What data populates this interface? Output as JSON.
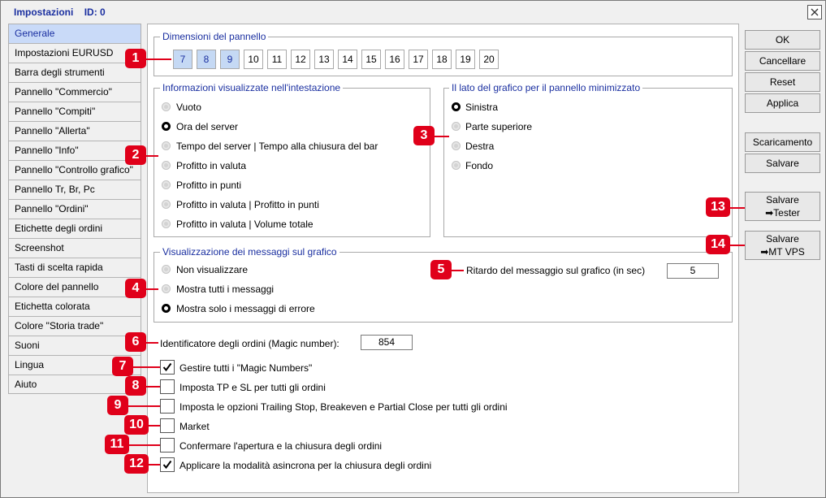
{
  "window": {
    "title": "Impostazioni",
    "id_label": "ID: 0"
  },
  "sidebar": {
    "items": [
      {
        "label": "Generale",
        "active": true
      },
      {
        "label": "Impostazioni EURUSD"
      },
      {
        "label": "Barra degli strumenti"
      },
      {
        "label": "Pannello \"Commercio\""
      },
      {
        "label": "Pannello \"Compiti\""
      },
      {
        "label": "Pannello \"Allerta\""
      },
      {
        "label": "Pannello \"Info\""
      },
      {
        "label": "Pannello \"Controllo grafico\""
      },
      {
        "label": "Pannello Tr, Br, Pc"
      },
      {
        "label": "Pannello \"Ordini\""
      },
      {
        "label": "Etichette degli ordini"
      },
      {
        "label": "Screenshot"
      },
      {
        "label": "Tasti di scelta rapida"
      },
      {
        "label": "Colore del pannello"
      },
      {
        "label": "Etichetta colorata"
      },
      {
        "label": "Colore \"Storia trade\""
      },
      {
        "label": "Suoni"
      },
      {
        "label": "Lingua"
      },
      {
        "label": "Aiuto"
      }
    ]
  },
  "panel_size": {
    "legend": "Dimensioni del pannello",
    "options": [
      "7",
      "8",
      "9",
      "10",
      "11",
      "12",
      "13",
      "14",
      "15",
      "16",
      "17",
      "18",
      "19",
      "20"
    ],
    "selected": [
      "7",
      "8",
      "9"
    ]
  },
  "header_info": {
    "legend": "Informazioni visualizzate nell'intestazione",
    "options": [
      "Vuoto",
      "Ora del server",
      "Tempo del server | Tempo alla chiusura del bar",
      "Profitto in valuta",
      "Profitto in punti",
      "Profitto in valuta | Profitto in punti",
      "Profitto in valuta | Volume totale"
    ],
    "selected": "Ora del server"
  },
  "minimized_side": {
    "legend": "Il lato del grafico per il pannello minimizzato",
    "options": [
      "Sinistra",
      "Parte superiore",
      "Destra",
      "Fondo"
    ],
    "selected": "Sinistra"
  },
  "messages": {
    "legend": "Visualizzazione dei messaggi sul grafico",
    "options": [
      "Non visualizzare",
      "Mostra tutti i messaggi",
      "Mostra solo i messaggi di errore"
    ],
    "selected": "Mostra solo i messaggi di errore",
    "delay_label": "Ritardo del messaggio sul grafico (in sec)",
    "delay_value": "5"
  },
  "magic": {
    "label": "Identificatore degli ordini (Magic number):",
    "value": "854"
  },
  "checkboxes": [
    {
      "label": "Gestire tutti i \"Magic Numbers\"",
      "checked": true
    },
    {
      "label": "Imposta TP e SL per tutti gli ordini",
      "checked": false
    },
    {
      "label": "Imposta le opzioni Trailing Stop, Breakeven e Partial Close per tutti gli ordini",
      "checked": false
    },
    {
      "label": "Market",
      "checked": false
    },
    {
      "label": "Confermare l'apertura e la chiusura degli ordini",
      "checked": false
    },
    {
      "label": "Applicare la modalità asincrona per la chiusura degli ordini",
      "checked": true
    }
  ],
  "buttons": {
    "ok": "OK",
    "cancel": "Cancellare",
    "reset": "Reset",
    "apply": "Applica",
    "download": "Scaricamento",
    "save": "Salvare",
    "save_tester_1": "Salvare",
    "save_tester_2": "➡Tester",
    "save_vps_1": "Salvare",
    "save_vps_2": "➡MT VPS"
  },
  "callouts": [
    "1",
    "2",
    "3",
    "4",
    "5",
    "6",
    "7",
    "8",
    "9",
    "10",
    "11",
    "12",
    "13",
    "14"
  ],
  "colors": {
    "accent": "#1a2fa0",
    "callout": "#e0001a",
    "selected_bg": "#c9daf8"
  }
}
